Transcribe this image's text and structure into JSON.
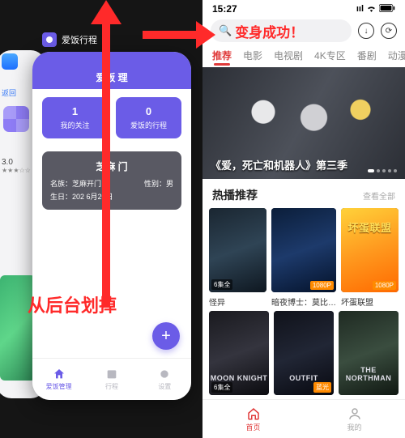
{
  "left": {
    "app_name": "爱饭行程",
    "back_label": "返回",
    "rating_value": "3.0",
    "phone": {
      "header_title": "爱饭   理",
      "stats": [
        {
          "value": "1",
          "label": "我的关注"
        },
        {
          "value": "0",
          "label": "爱饭的行程"
        }
      ],
      "info_title": "芝麻   门",
      "info_rows": [
        {
          "l": "名族：芝麻开门",
          "r": "性别：男"
        },
        {
          "l": "生日：202  6月20日",
          "r": ""
        }
      ],
      "tabs": [
        {
          "label": "爱饭管理",
          "active": true
        },
        {
          "label": "行程",
          "active": false
        },
        {
          "label": "设置",
          "active": false
        }
      ],
      "fab_label": "+"
    },
    "annotation": "从后台划掉"
  },
  "right": {
    "status_time": "15:27",
    "annotation": "变身成功！",
    "nav_tabs": [
      "推荐",
      "电影",
      "电视剧",
      "4K专区",
      "番剧",
      "动漫"
    ],
    "active_tab_index": 0,
    "hero_caption": "《爱，死亡和机器人》第三季",
    "section_title": "热播推荐",
    "section_more": "查看全部",
    "cards_row1": [
      {
        "title": "怪异",
        "badge_l": "6集全",
        "badge_r": ""
      },
      {
        "title": "暗夜博士：莫比…",
        "badge_l": "",
        "badge_r": "1080P"
      },
      {
        "title": "坏蛋联盟",
        "badge_l": "",
        "badge_r": "1080P",
        "poster_text": "坏蛋联盟"
      }
    ],
    "cards_row2": [
      {
        "title": "",
        "badge_l": "6集全",
        "badge_r": "",
        "poster_text": "MOON KNIGHT"
      },
      {
        "title": "",
        "badge_l": "",
        "badge_r": "蓝光",
        "poster_text": "OUTFIT"
      },
      {
        "title": "",
        "badge_l": "",
        "badge_r": "",
        "poster_text": "THE NORTHMAN"
      }
    ],
    "bottom_tabs": [
      {
        "label": "首页",
        "active": true
      },
      {
        "label": "我的",
        "active": false
      }
    ]
  }
}
